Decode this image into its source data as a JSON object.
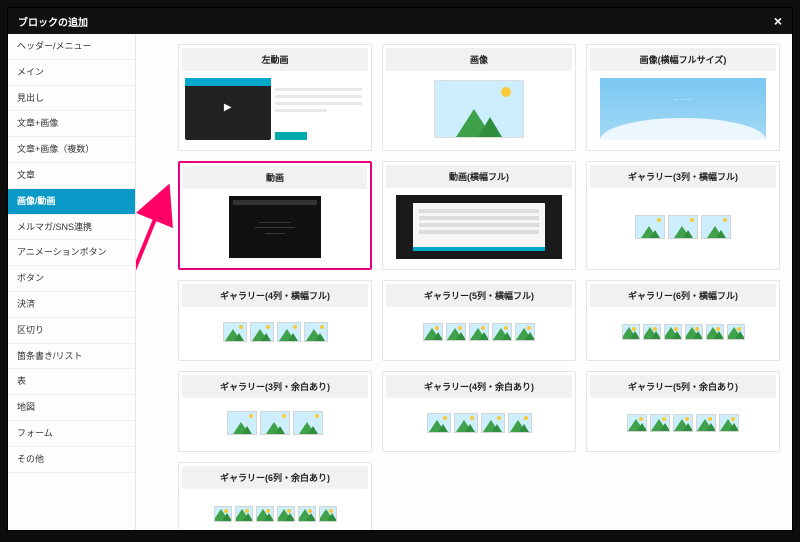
{
  "modal": {
    "title": "ブロックの追加",
    "close_label": "×"
  },
  "sidebar": {
    "items": [
      {
        "label": "ヘッダー/メニュー",
        "active": false
      },
      {
        "label": "メイン",
        "active": false
      },
      {
        "label": "見出し",
        "active": false
      },
      {
        "label": "文章+画像",
        "active": false
      },
      {
        "label": "文章+画像（複数）",
        "active": false
      },
      {
        "label": "文章",
        "active": false
      },
      {
        "label": "画像/動画",
        "active": true
      },
      {
        "label": "メルマガ/SNS連携",
        "active": false
      },
      {
        "label": "アニメーションボタン",
        "active": false
      },
      {
        "label": "ボタン",
        "active": false
      },
      {
        "label": "決済",
        "active": false
      },
      {
        "label": "区切り",
        "active": false
      },
      {
        "label": "箇条書き/リスト",
        "active": false
      },
      {
        "label": "表",
        "active": false
      },
      {
        "label": "地図",
        "active": false
      },
      {
        "label": "フォーム",
        "active": false
      },
      {
        "label": "その他",
        "active": false
      }
    ]
  },
  "blocks": [
    {
      "title": "左動画",
      "preview": "leftvideo",
      "highlighted": false
    },
    {
      "title": "画像",
      "preview": "image",
      "highlighted": false
    },
    {
      "title": "画像(横幅フルサイズ)",
      "preview": "fullimage",
      "highlighted": false
    },
    {
      "title": "動画",
      "preview": "video",
      "highlighted": true
    },
    {
      "title": "動画(横幅フル)",
      "preview": "videofull",
      "highlighted": false
    },
    {
      "title": "ギャラリー(3列・横幅フル)",
      "preview": "gallery3",
      "highlighted": false,
      "compact": true
    },
    {
      "title": "ギャラリー(4列・横幅フル)",
      "preview": "gallery4",
      "highlighted": false,
      "compact": true
    },
    {
      "title": "ギャラリー(5列・横幅フル)",
      "preview": "gallery5",
      "highlighted": false,
      "compact": true
    },
    {
      "title": "ギャラリー(6列・横幅フル)",
      "preview": "gallery6",
      "highlighted": false,
      "compact": true
    },
    {
      "title": "ギャラリー(3列・余白あり)",
      "preview": "gallery3",
      "highlighted": false,
      "compact": true
    },
    {
      "title": "ギャラリー(4列・余白あり)",
      "preview": "gallery4",
      "highlighted": false,
      "compact": true
    },
    {
      "title": "ギャラリー(5列・余白あり)",
      "preview": "gallery5",
      "highlighted": false,
      "compact": true
    },
    {
      "title": "ギャラリー(6列・余白あり)",
      "preview": "gallery6",
      "highlighted": false,
      "compact": true,
      "lastrow": true
    }
  ],
  "colors": {
    "accent": "#0899c6",
    "highlight": "#e6007e",
    "arrow": "#ff0066"
  }
}
